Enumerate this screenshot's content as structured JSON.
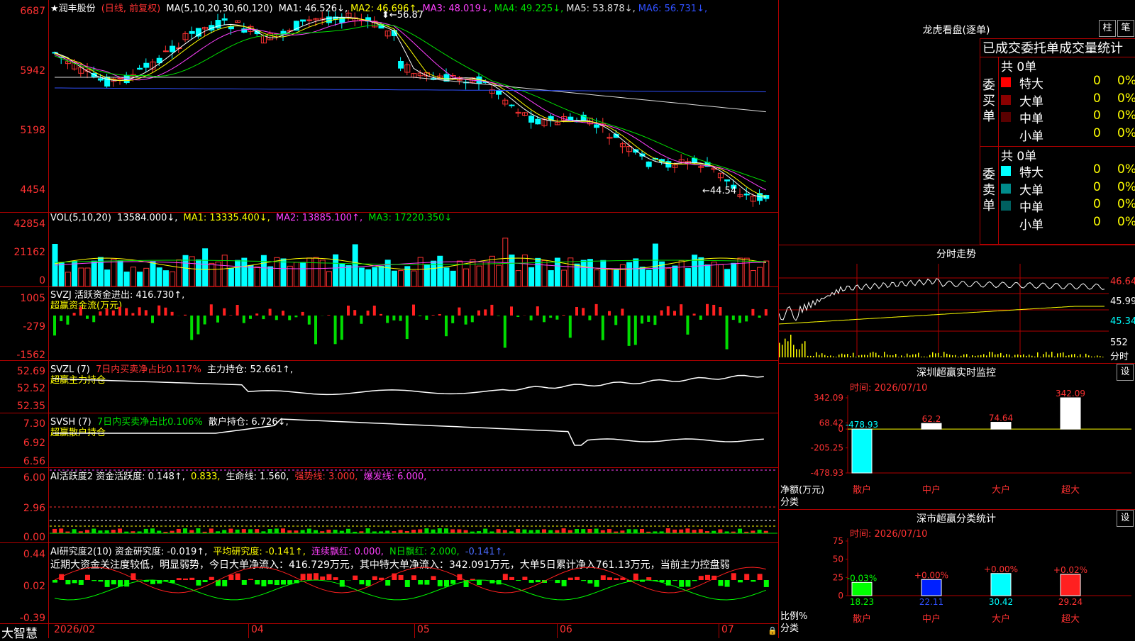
{
  "stock": {
    "name": "★润丰股份",
    "period": "(日线, 前复权)",
    "ma_label": "MA(5,10,20,30,60,120)",
    "ma": [
      {
        "k": "MA1:",
        "v": "46.526",
        "arrow": "↓",
        "color": "#ffffff"
      },
      {
        "k": "MA2:",
        "v": "46.696",
        "arrow": "↑",
        "color": "#ffff00"
      },
      {
        "k": "MA3:",
        "v": "48.019",
        "arrow": "↓",
        "color": "#ff40ff"
      },
      {
        "k": "MA4:",
        "v": "49.225",
        "arrow": "↓",
        "color": "#00e000"
      },
      {
        "k": "MA5:",
        "v": "53.878",
        "arrow": "↓",
        "color": "#dddddd"
      },
      {
        "k": "MA6:",
        "v": "56.731",
        "arrow": "↓",
        "color": "#3050ff"
      }
    ],
    "price_axis": [
      "6687",
      "5942",
      "5198",
      "4454"
    ],
    "high_marker": "56.87",
    "low_marker": "44.54"
  },
  "vol": {
    "label": "VOL(5,10,20)",
    "value": "13584.000↓,",
    "ma1": "MA1: 13335.400↓,",
    "ma2": "MA2: 13885.100↑,",
    "ma3": "MA3: 17220.350↓",
    "axis": [
      "42854",
      "21162",
      "0"
    ]
  },
  "svzj": {
    "label": "SVZJ  活跃资金进出: 416.730↑,",
    "sub": "超赢资金流(万元)",
    "axis": [
      "1005",
      "-279",
      "-1562"
    ]
  },
  "svzl": {
    "label": "SVZL (7)",
    "pct": "7日内买卖净占比0.117%",
    "hold": "主力持仓: 52.661↑,",
    "sub": "超赢主力持仓",
    "axis": [
      "52.69",
      "52.52",
      "52.35"
    ]
  },
  "svsh": {
    "label": "SVSH (7)",
    "pct": "7日内买卖净占比0.106%",
    "hold": "散户持仓: 6.726↓,",
    "sub": "超赢散户持仓",
    "axis": [
      "7.30",
      "6.92",
      "6.56"
    ]
  },
  "ai1": {
    "label": "AI活跃度2 资金活跃度: 0.148↑,",
    "v2": "0.833,",
    "life": "生命线: 1.560,",
    "strong": "强势线: 3.000,",
    "burst": "爆发线: 6.000,",
    "axis": [
      "6.00",
      "2.96",
      "0.00"
    ]
  },
  "ai2": {
    "label": "AI研究度2(10) 资金研究度: -0.019↑,",
    "avg": "平均研究度: -0.141↑,",
    "red": "连续飘红: 0.000,",
    "n": "N日飘红: 2.000,",
    "last": "-0.141↑,",
    "comment": "近期大资金关注度较低，明显弱势，今日大单净流入：416.729万元，其中特大单净流入：342.091万元，大单5日累计净入761.13万元，当前主力控盘弱",
    "axis": [
      "0.44",
      "0.02",
      "-0.39"
    ]
  },
  "xaxis": {
    "brand": "大智慧",
    "labels": [
      "2026/02",
      "04",
      "05",
      "06",
      "07"
    ]
  },
  "lhb": {
    "title": "龙虎看盘(逐单)",
    "btn1": "柱",
    "btn2": "笔",
    "tabs": "已成交委托单成交量统计",
    "buy_side": "委买单",
    "sell_side": "委卖单",
    "buy_total": "共 0单",
    "sell_total": "共 0单",
    "buy_rows": [
      {
        "label": "特大",
        "val": "0",
        "pct": "0%",
        "color": "#ff0000"
      },
      {
        "label": "大单",
        "val": "0",
        "pct": "0%",
        "color": "#8b0000"
      },
      {
        "label": "中单",
        "val": "0",
        "pct": "0%",
        "color": "#5a0000"
      },
      {
        "label": "小单",
        "val": "0",
        "pct": "0%",
        "color": "#000000"
      }
    ],
    "sell_rows": [
      {
        "label": "特大",
        "val": "0",
        "pct": "0%",
        "color": "#00ffff"
      },
      {
        "label": "大单",
        "val": "0",
        "pct": "0%",
        "color": "#008b8b"
      },
      {
        "label": "中单",
        "val": "0",
        "pct": "0%",
        "color": "#006060"
      },
      {
        "label": "小单",
        "val": "0",
        "pct": "0%",
        "color": "#000000"
      }
    ]
  },
  "intraday": {
    "title": "分时走势",
    "axis": [
      "46.64",
      "45.99",
      "45.34",
      "552"
    ],
    "unit": "分时"
  },
  "sz_monitor": {
    "title": "深圳超赢实时监控",
    "btn": "设",
    "time": "时间: 2026/07/10",
    "ylabel": "净额(万元)",
    "xlabel": "分类",
    "axis": [
      "342.09",
      "68.42",
      "0",
      "-205.25",
      "-478.93"
    ]
  },
  "sz_stats": {
    "title": "深市超赢分类统计",
    "btn": "设",
    "time": "时间: 2026/07/10",
    "ylabel": "比例%",
    "xlabel": "分类",
    "axis": [
      "75",
      "50",
      "25",
      "0"
    ]
  },
  "chart_data": [
    {
      "type": "bar",
      "title": "深圳超赢实时监控",
      "ylabel": "净额(万元)",
      "xlabel": "分类",
      "categories": [
        "散户",
        "中户",
        "大户",
        "超大"
      ],
      "values": [
        -478.93,
        62.2,
        74.64,
        342.09
      ],
      "ylim": [
        -478.93,
        342.09
      ]
    },
    {
      "type": "bar",
      "title": "深市超赢分类统计",
      "ylabel": "比例%",
      "xlabel": "分类",
      "categories": [
        "散户",
        "中户",
        "大户",
        "超大"
      ],
      "values": [
        18.23,
        22.11,
        30.42,
        29.24
      ],
      "changes": [
        "-0.03%",
        "+0.00%",
        "+0.00%",
        "+0.02%"
      ],
      "ylim": [
        0,
        75
      ]
    }
  ]
}
